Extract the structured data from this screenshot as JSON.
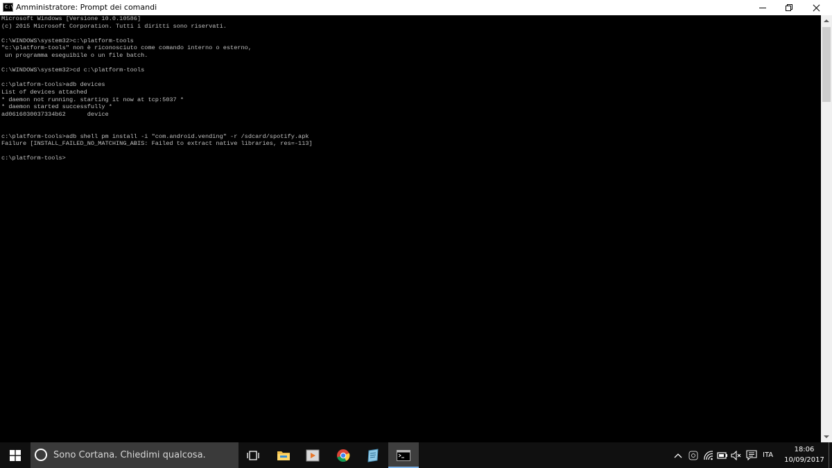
{
  "window": {
    "title": "Amministratore: Prompt dei comandi",
    "icon_label": "C:\\",
    "buttons": [
      "minimize-icon",
      "restore-icon",
      "close-icon"
    ]
  },
  "console": {
    "lines": [
      "Microsoft Windows [Versione 10.0.10586]",
      "(c) 2015 Microsoft Corporation. Tutti i diritti sono riservati.",
      "",
      "C:\\WINDOWS\\system32>c:\\platform-tools",
      "\"c:\\platform-tools\" non è riconosciuto come comando interno o esterno,",
      " un programma eseguibile o un file batch.",
      "",
      "C:\\WINDOWS\\system32>cd c:\\platform-tools",
      "",
      "c:\\platform-tools>adb devices",
      "List of devices attached",
      "* daemon not running. starting it now at tcp:5037 *",
      "* daemon started successfully *",
      "ad0616030037334b62      device",
      "",
      "",
      "c:\\platform-tools>adb shell pm install -i \"com.android.vending\" -r /sdcard/spotify.apk",
      "Failure [INSTALL_FAILED_NO_MATCHING_ABIS: Failed to extract native libraries, res=-113]",
      "",
      "c:\\platform-tools>"
    ],
    "text_color": "#c0c0c0",
    "background": "#000000"
  },
  "taskbar": {
    "search_placeholder": "Sono Cortana. Chiedimi qualcosa.",
    "pinned": [
      "task-view-icon",
      "file-explorer-icon",
      "media-player-icon",
      "chrome-icon",
      "notepad-icon",
      "command-prompt-icon"
    ],
    "tray": {
      "icons": [
        "chevron-up-icon",
        "app-tray-icon",
        "network-icon",
        "battery-icon",
        "volume-muted-icon",
        "action-center-icon"
      ],
      "language": "ITA",
      "time": "18:06",
      "date": "10/09/2017"
    },
    "accent_color": "#7eb4ea"
  }
}
